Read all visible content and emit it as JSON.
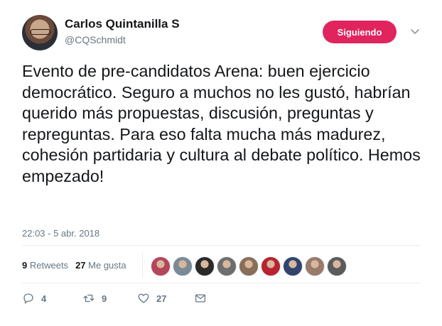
{
  "user": {
    "name": "Carlos Quintanilla S",
    "handle": "@CQSchmidt"
  },
  "follow_button": {
    "label": "Siguiendo",
    "color": "#e0245e"
  },
  "tweet": {
    "text": "Evento de pre-candidatos Arena: buen ejercicio democrático. Seguro a muchos no les gustó, habrían querido más propuestas, discusión, preguntas y repreguntas. Para eso falta mucha más madurez, cohesión partidaria y cultura al debate político. Hemos empezado!",
    "timestamp": "22:03 - 5 abr. 2018"
  },
  "stats": {
    "retweets_count": "9",
    "retweets_label": "Retweets",
    "likes_count": "27",
    "likes_label": "Me gusta"
  },
  "liker_avatar_colors": [
    "#b5455a",
    "#7b8a96",
    "#2a2a2a",
    "#6e6e6e",
    "#8a6e58",
    "#b8232f",
    "#31436e",
    "#9a7a6a",
    "#5b5b5b"
  ],
  "actions": {
    "reply_count": "4",
    "retweet_count": "9",
    "like_count": "27"
  },
  "icons": [
    "chevron-down-icon",
    "reply-icon",
    "retweet-icon",
    "heart-icon",
    "message-icon"
  ]
}
